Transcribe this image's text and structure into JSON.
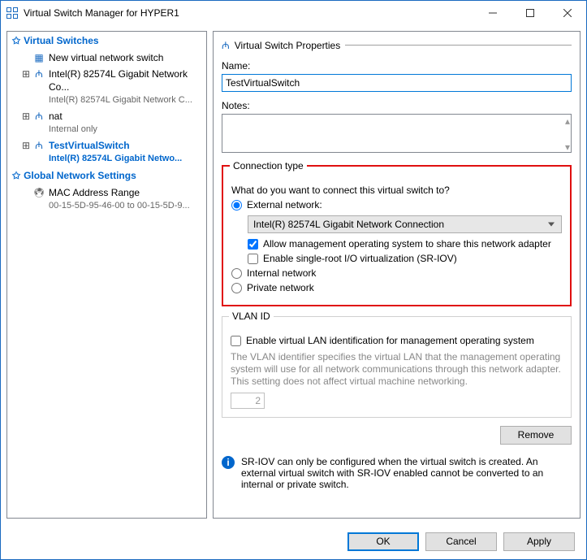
{
  "window": {
    "title": "Virtual Switch Manager for HYPER1"
  },
  "tree": {
    "heading1": "Virtual Switches",
    "new_switch": "New virtual network switch",
    "sw1_name": "Intel(R) 82574L Gigabit Network Co...",
    "sw1_sub": "Intel(R) 82574L Gigabit Network C...",
    "sw2_name": "nat",
    "sw2_sub": "Internal only",
    "sw3_name": "TestVirtualSwitch",
    "sw3_sub": "Intel(R) 82574L Gigabit Netwo...",
    "heading2": "Global Network Settings",
    "mac_label": "MAC Address Range",
    "mac_sub": "00-15-5D-95-46-00 to 00-15-5D-9..."
  },
  "props": {
    "section_title": "Virtual Switch Properties",
    "name_label": "Name:",
    "name_value": "TestVirtualSwitch",
    "notes_label": "Notes:"
  },
  "conn": {
    "legend": "Connection type",
    "question": "What do you want to connect this virtual switch to?",
    "external": "External network:",
    "adapter": "Intel(R) 82574L Gigabit Network Connection",
    "allow_mgmt": "Allow management operating system to share this network adapter",
    "sriov": "Enable single-root I/O virtualization (SR-IOV)",
    "internal": "Internal network",
    "private": "Private network"
  },
  "vlan": {
    "legend": "VLAN ID",
    "enable": "Enable virtual LAN identification for management operating system",
    "desc": "The VLAN identifier specifies the virtual LAN that the management operating system will use for all network communications through this network adapter. This setting does not affect virtual machine networking.",
    "value": "2"
  },
  "remove": "Remove",
  "info": "SR-IOV can only be configured when the virtual switch is created. An external virtual switch with SR-IOV enabled cannot be converted to an internal or private switch.",
  "buttons": {
    "ok": "OK",
    "cancel": "Cancel",
    "apply": "Apply"
  }
}
